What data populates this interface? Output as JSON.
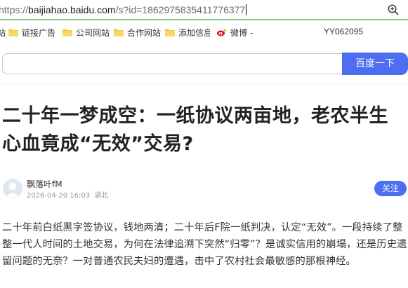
{
  "address_bar": {
    "url_prefix": "https://",
    "url_domain": "baijiahao.baidu.com",
    "url_path": "/s?id=1862975835411776377"
  },
  "bookmarks": [
    {
      "label": "站",
      "icon": "folder-icon"
    },
    {
      "label": "链接广告",
      "icon": "folder-icon"
    },
    {
      "label": "公司网站",
      "icon": "folder-icon"
    },
    {
      "label": "合作网站",
      "icon": "folder-icon"
    },
    {
      "label": "添加信息",
      "icon": "folder-icon"
    },
    {
      "label": "微博 -",
      "icon": "weibo-icon"
    },
    {
      "label": "YY062095",
      "icon": ""
    }
  ],
  "search": {
    "value": "",
    "button_label": "百度一下"
  },
  "article": {
    "title": "二十年一梦成空：一纸协议两亩地，老农半生心血竟成“无效”交易?",
    "author_name": "飘落叶fM",
    "datetime": "2026-04-20 16:03",
    "location": "湖北",
    "follow_label": "关注",
    "body": "二十年前白纸黑字签协议，钱地两清；二十年后F院一纸判决，认定“无效”。一段持续了整整一代人时间的土地交易，为何在法律追溯下突然“归零”？是诚实信用的崩塌，还是历史遗留问题的无奈？一对普通农民夫妇的遭遇，击中了农村社会最敏感的那根神经。"
  },
  "colors": {
    "accent": "#4e6ef2",
    "address_border": "#7fd07f",
    "folder": "#f2c94c"
  }
}
